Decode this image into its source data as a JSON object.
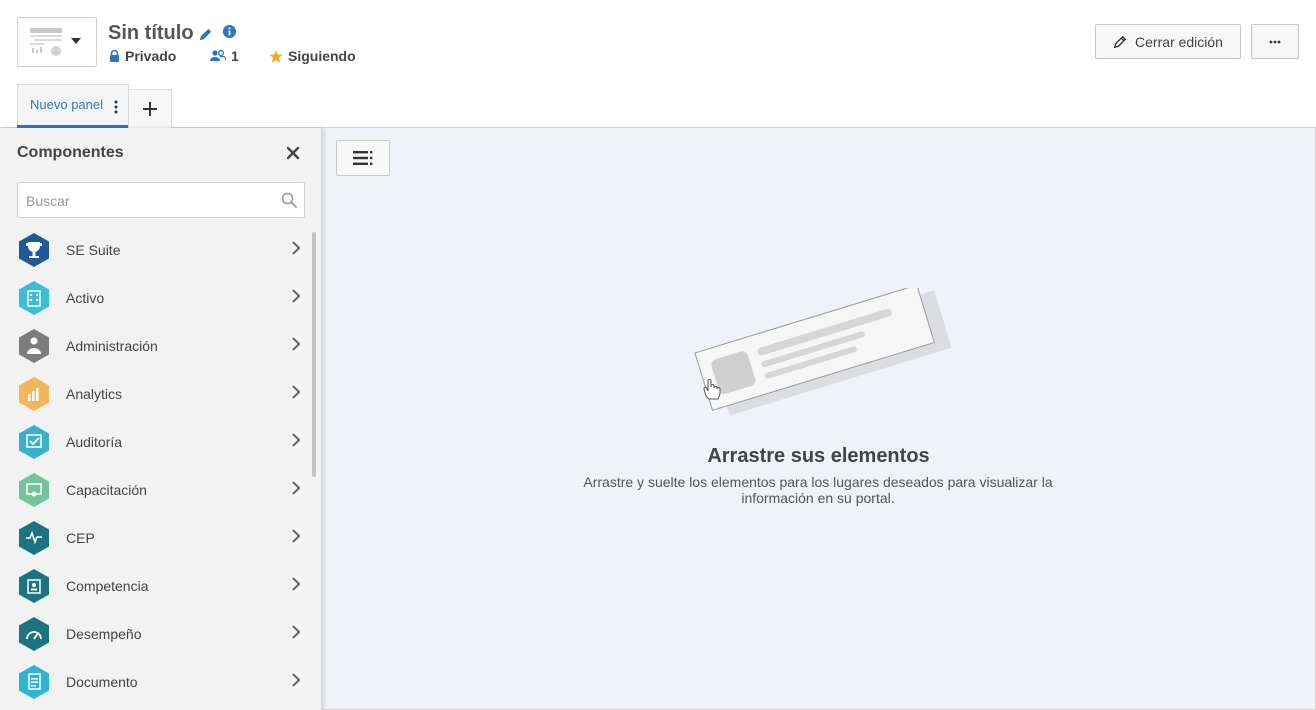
{
  "header": {
    "title": "Sin título",
    "privacy": "Privado",
    "members": "1",
    "following": "Siguiendo",
    "close_edit": "Cerrar edición",
    "more": "..."
  },
  "tabs": [
    {
      "label": "Nuevo panel",
      "active": true
    }
  ],
  "sidebar": {
    "title": "Componentes",
    "search_placeholder": "Buscar",
    "items": [
      {
        "label": "SE Suite",
        "icon": "trophy-icon",
        "color": "#1e5a96"
      },
      {
        "label": "Activo",
        "icon": "building-icon",
        "color": "#3bbcd8"
      },
      {
        "label": "Administración",
        "icon": "admin-user-icon",
        "color": "#7d7d7d"
      },
      {
        "label": "Analytics",
        "icon": "bar-chart-icon",
        "color": "#f3b65b"
      },
      {
        "label": "Auditoría",
        "icon": "audit-check-icon",
        "color": "#3bb0cc"
      },
      {
        "label": "Capacitación",
        "icon": "certificate-icon",
        "color": "#74c39a"
      },
      {
        "label": "CEP",
        "icon": "pulse-icon",
        "color": "#1b7480"
      },
      {
        "label": "Competencia",
        "icon": "id-badge-icon",
        "color": "#1b7480"
      },
      {
        "label": "Desempeño",
        "icon": "gauge-icon",
        "color": "#1b7480"
      },
      {
        "label": "Documento",
        "icon": "document-icon",
        "color": "#2fb5d4"
      }
    ]
  },
  "canvas": {
    "empty_title": "Arrastre sus elementos",
    "empty_desc": "Arrastre y suelte los elementos para los lugares deseados para visualizar la información en su portal."
  },
  "colors": {
    "accent": "#2a78c2",
    "star": "#f5a623",
    "canvas_bg": "#eff2f6"
  }
}
